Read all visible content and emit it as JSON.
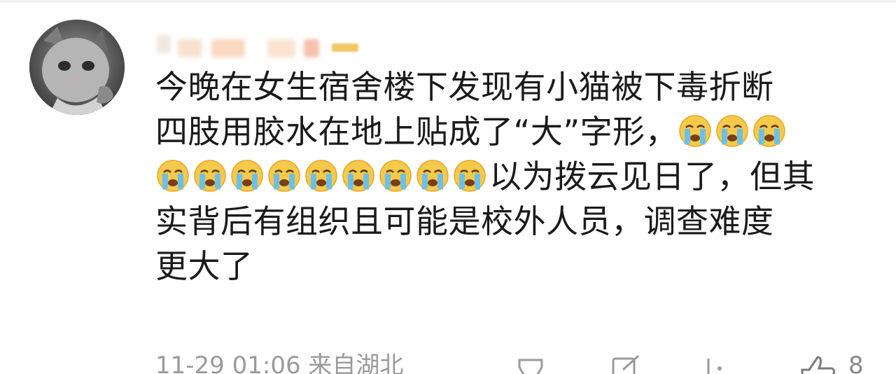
{
  "comment": {
    "lines": [
      [
        "今晚在女生宿舍楼下发现有小猫被下毒折断"
      ],
      [
        "四肢用胶水在地上贴成了“大”字形，",
        "crying-emoji",
        "crying-emoji",
        "crying-emoji"
      ],
      [
        "crying-emoji",
        "crying-emoji",
        "crying-emoji",
        "crying-emoji",
        "crying-emoji",
        "crying-emoji",
        "crying-emoji",
        "crying-emoji",
        "crying-emoji",
        "以为拨云见日了，但其"
      ],
      [
        "实背后有组织且可能是校外人员，调查难度"
      ],
      [
        "更大了"
      ]
    ],
    "timestamp": "11-29 01:06 来自湖北",
    "like_count": "8"
  },
  "icons": {
    "avatar": "cat-avatar",
    "emoji": "crying-emoji",
    "share": "share-icon",
    "comment": "comment-icon",
    "more": "more-icon",
    "like": "like-icon"
  },
  "colors": {
    "text": "#1a1a1a",
    "meta": "#9a9a9a",
    "emoji_face": "#f7c94a",
    "emoji_tear": "#6cc0e8",
    "badge": "#f3c766"
  }
}
